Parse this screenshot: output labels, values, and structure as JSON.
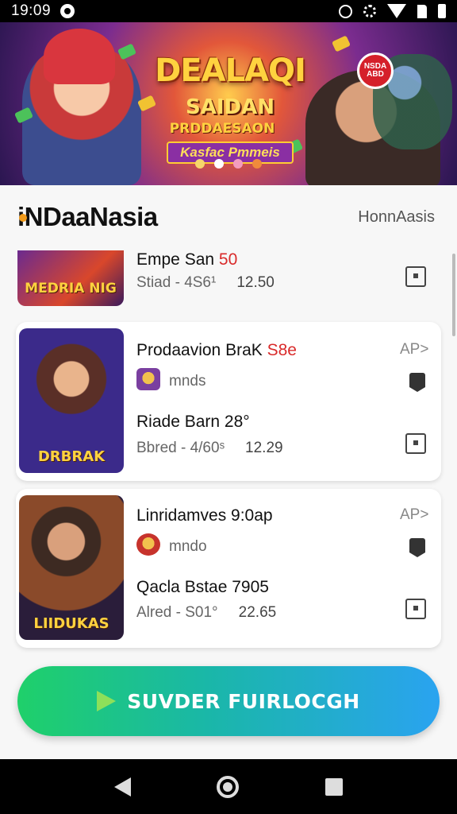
{
  "status_bar": {
    "time": "19:09",
    "icons": [
      "circle-notification-icon",
      "alarm-icon",
      "settings-icon",
      "wifi-icon",
      "signal-icon",
      "battery-icon"
    ]
  },
  "banner": {
    "title": "DEALAQI",
    "line1": "SAIDAN",
    "line2": "PRDDAESAON",
    "line3": "Kasfac Pmmeis",
    "badge": "NSDA ABD",
    "dots": [
      "yellow",
      "active",
      "pink",
      "orange"
    ]
  },
  "header": {
    "brand": "iNDaaNasia",
    "right_link": "HonnAasis"
  },
  "items": [
    {
      "thumb_label": "MEDRIA NIG",
      "title": "Empe San",
      "title_accent": "50",
      "meta_prefix": "Stiad - 4S6¹",
      "meta_value": "12.50"
    },
    {
      "thumb_label": "DRBRAK",
      "title": "Prodaavion BraK",
      "title_accent": "S8e",
      "app_tag": "AP>",
      "sub": "mnds",
      "title2": "Riade Barn 28°",
      "meta_prefix": "Bbred - 4/60ˢ",
      "meta_value": "12.29"
    },
    {
      "thumb_label": "LIIDUKAS",
      "title": "Linridamves 9:0ap",
      "title_accent": "",
      "app_tag": "AP>",
      "sub": "mndo",
      "title2": "Qacla Bstae 7905",
      "meta_prefix": "Alred - S01°",
      "meta_value": "22.65"
    }
  ],
  "cta": {
    "label": "SUVDER FUIRLOCGH"
  },
  "colors": {
    "accent": "#d92b2b",
    "cta_start": "#1fd06a",
    "cta_end": "#2aa3f0",
    "brand_dot": "#f29b1a"
  }
}
